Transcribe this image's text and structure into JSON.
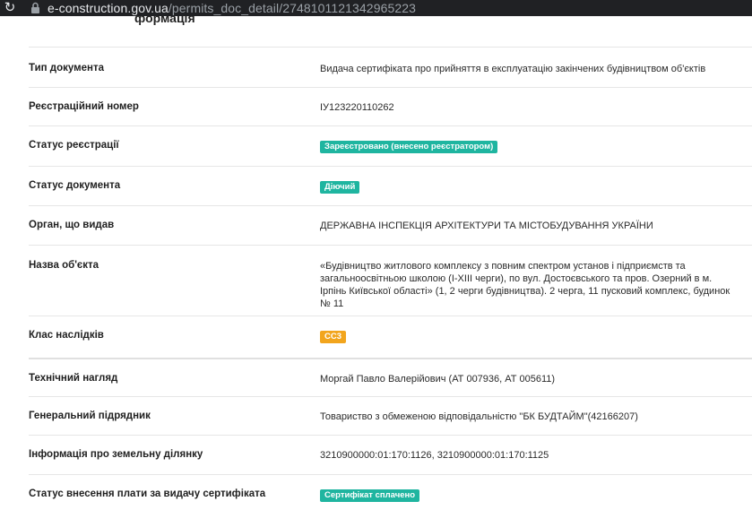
{
  "browser": {
    "url_host": "e-construction.gov.ua",
    "url_path": "/permits_doc_detail/2748101121342965223"
  },
  "page": {
    "cut_title": "формація"
  },
  "rows": [
    {
      "label": "Тип документа",
      "value": "Видача сертифіката про прийняття в експлуатацію закінчених будівництвом об'єктів"
    },
    {
      "label": "Реєстраційний номер",
      "value": "ІУ123220110262"
    },
    {
      "label": "Статус реєстрації",
      "value": "Зареєстровано (внесено реєстратором)"
    },
    {
      "label": "Статус документа",
      "value": "Діючий"
    },
    {
      "label": "Орган, що видав",
      "value": "ДЕРЖАВНА ІНСПЕКЦІЯ АРХІТЕКТУРИ ТА МІСТОБУДУВАННЯ УКРАЇНИ"
    },
    {
      "label": "Назва об'єкта",
      "value": "«Будівництво житлового комплексу з повним спектром установ і підприємств та загальноосвітньою школою (І-ХІІІ черги), по вул. Достоєвського та пров. Озерний в м. Ірпінь Київської області» (1, 2 черги будівництва). 2 черга, 11 пусковий комплекс, будинок № 11"
    },
    {
      "label": "Клас наслідків",
      "value": "СС3"
    },
    {
      "label": "Технічний нагляд",
      "value": "Моргай Павло Валерійович (АТ 007936, АТ 005611)"
    },
    {
      "label": "Генеральний підрядник",
      "value": "Товариство з обмеженою відповідальністю \"БК БУДТАЙМ\"(42166207)"
    },
    {
      "label": "Інформація про земельну ділянку",
      "value": "3210900000:01:170:1126, 3210900000:01:170:1125"
    },
    {
      "label": "Статус внесення плати за видачу сертифіката",
      "value": "Сертифікат сплачено"
    }
  ],
  "colors": {
    "badge_teal": "#1fb5a0",
    "badge_orange": "#f2a51d",
    "browser_bar": "#202124"
  }
}
